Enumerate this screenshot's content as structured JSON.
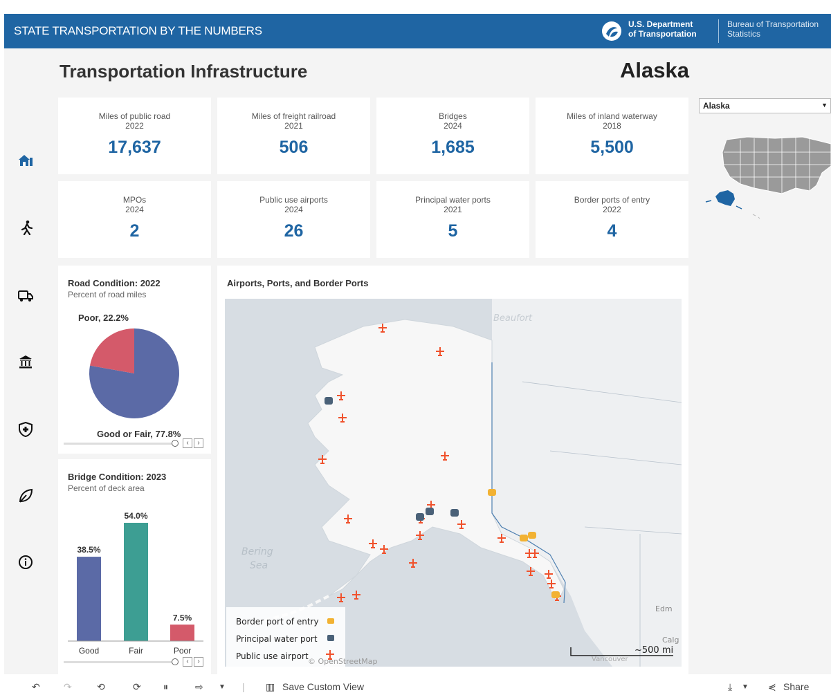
{
  "header": {
    "app_title": "STATE TRANSPORTATION BY THE NUMBERS",
    "dept_line1": "U.S. Department",
    "dept_line2": "of Transportation",
    "bureau_line1": "Bureau of Transportation",
    "bureau_line2": "Statistics"
  },
  "page": {
    "title": "Transportation Infrastructure",
    "state": "Alaska"
  },
  "selector": {
    "selected": "Alaska"
  },
  "stats": [
    {
      "label": "Miles of public road",
      "year": "2022",
      "value": "17,637"
    },
    {
      "label": "Miles of freight railroad",
      "year": "2021",
      "value": "506"
    },
    {
      "label": "Bridges",
      "year": "2024",
      "value": "1,685"
    },
    {
      "label": "Miles of inland waterway",
      "year": "2018",
      "value": "5,500"
    },
    {
      "label": "MPOs",
      "year": "2024",
      "value": "2"
    },
    {
      "label": "Public use airports",
      "year": "2024",
      "value": "26"
    },
    {
      "label": "Principal water ports",
      "year": "2021",
      "value": "5"
    },
    {
      "label": "Border ports of entry",
      "year": "2022",
      "value": "4"
    }
  ],
  "road_condition": {
    "title": "Road Condition: 2022",
    "subtitle": "Percent of road miles",
    "poor_label": "Poor, 22.2%",
    "good_label": "Good or Fair, 77.8%"
  },
  "bridge_condition": {
    "title": "Bridge Condition: 2023",
    "subtitle": "Percent of deck area"
  },
  "map": {
    "title": "Airports, Ports, and Border Ports",
    "legend_border": "Border port of entry",
    "legend_water": "Principal water port",
    "legend_airport": "Public use airport",
    "scale": "~500 mi",
    "attribution": "© OpenStreetMap",
    "label_beaufort": "Beaufort",
    "label_bering": "Bering",
    "label_sea": "Sea",
    "label_edm": "Edm",
    "label_calg": "Calg",
    "label_vancouver": "Vancouver"
  },
  "toolbar": {
    "save_view": "Save Custom View",
    "share": "Share"
  },
  "colors": {
    "header": "#1f65a3",
    "value": "#1f65a3",
    "good": "#5b6aa6",
    "poor": "#d45a6a",
    "fair": "#3d9e93",
    "airport": "#f0522d",
    "border_port": "#f2b233",
    "water_port": "#4a6178"
  },
  "chart_data": [
    {
      "type": "pie",
      "title": "Road Condition: 2022",
      "subtitle": "Percent of road miles",
      "categories": [
        "Good or Fair",
        "Poor"
      ],
      "values": [
        77.8,
        22.2
      ],
      "labels": [
        "Good or Fair, 77.8%",
        "Poor, 22.2%"
      ]
    },
    {
      "type": "bar",
      "title": "Bridge Condition: 2023",
      "subtitle": "Percent of deck area",
      "categories": [
        "Good",
        "Fair",
        "Poor"
      ],
      "values": [
        38.5,
        54.0,
        7.5
      ],
      "labels": [
        "38.5%",
        "54.0%",
        "7.5%"
      ],
      "ylim": [
        0,
        60
      ]
    }
  ]
}
